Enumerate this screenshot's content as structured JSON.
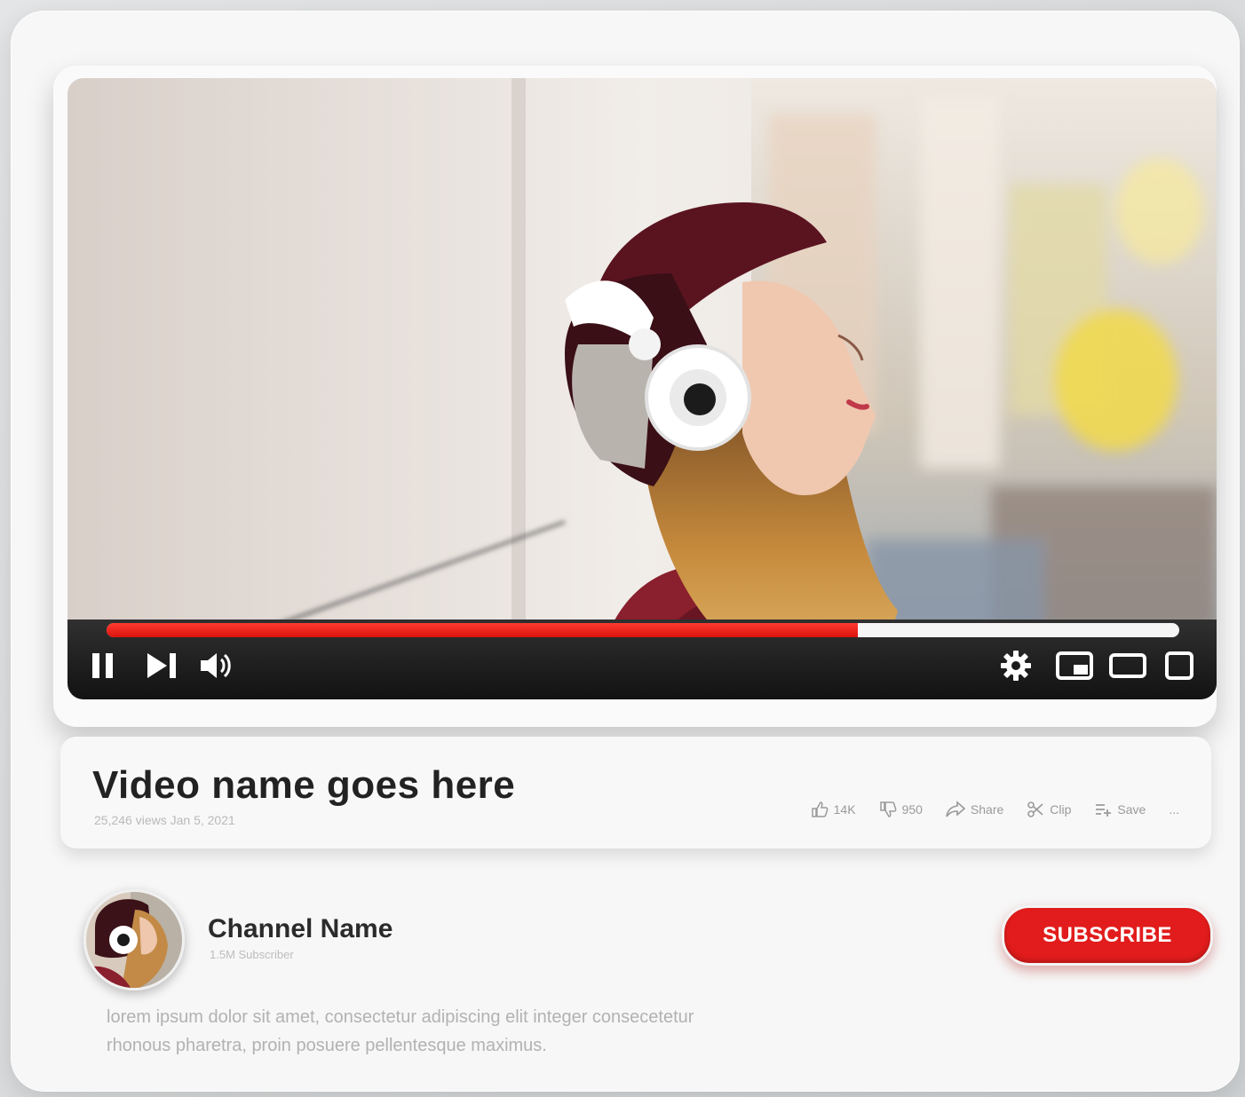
{
  "video": {
    "title": "Video name goes here",
    "meta": "25,246 views Jan 5, 2021",
    "progress_fraction": 0.7
  },
  "actions": {
    "like_count": "14K",
    "dislike_count": "950",
    "share_label": "Share",
    "clip_label": "Clip",
    "save_label": "Save",
    "more_label": "..."
  },
  "channel": {
    "name": "Channel Name",
    "subscribers": "1.5M Subscriber",
    "subscribe_label": "SUBSCRIBE"
  },
  "description": {
    "line1": "lorem ipsum dolor sit amet, consectetur adipiscing elit integer consecetetur",
    "line2": "rhonous pharetra, proin posuere pellentesque maximus."
  },
  "colors": {
    "brand_red": "#e21c1c",
    "progress_red": "#d9140e",
    "control_bar": "#1a1a1a"
  },
  "icons": {
    "pause": "pause-icon",
    "next": "skip-next-icon",
    "volume": "volume-icon",
    "settings": "gear-icon",
    "miniplayer": "miniplayer-icon",
    "theater": "theater-mode-icon",
    "fullscreen": "fullscreen-icon"
  }
}
